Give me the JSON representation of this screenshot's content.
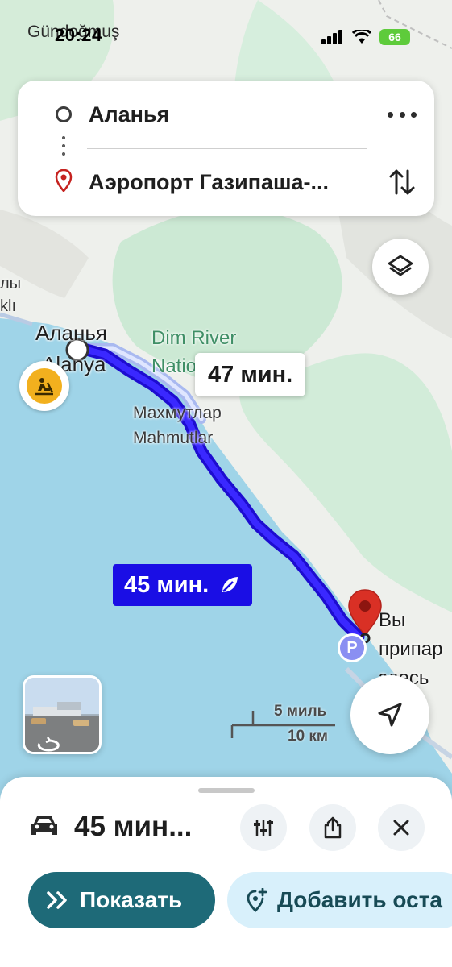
{
  "status_bar": {
    "back_app": "Gündoğmuş",
    "time": "20:24",
    "battery": "66"
  },
  "route_card": {
    "origin": "Аланья",
    "destination": "Аэропорт Газипаша-..."
  },
  "map": {
    "labels": {
      "city_ru": "Аланья",
      "city_tr": "Alanya",
      "park_line1": "Dim River",
      "park_line2": "Nation",
      "town_ru": "Махмутлар",
      "town_tr": "Mahmutlar",
      "edge_line1": "лы",
      "edge_line2": "klı",
      "arrive_line1": "Вы",
      "arrive_line2": "припар",
      "arrive_line3": "здесь"
    },
    "alt_route_time": "47 мин.",
    "main_route_time": "45 мин.",
    "parking_label": "P",
    "scale_top": "5 миль",
    "scale_bottom": "10 км",
    "colors": {
      "water": "#9ed3e6",
      "land": "#eef1ee",
      "green": "#c9e8d2",
      "route": "#2a0ff0",
      "destination_pin": "#d93025"
    }
  },
  "bottom_sheet": {
    "duration": "45 мин...",
    "show_button": "Показать",
    "add_stop_button": "Добавить оста"
  }
}
